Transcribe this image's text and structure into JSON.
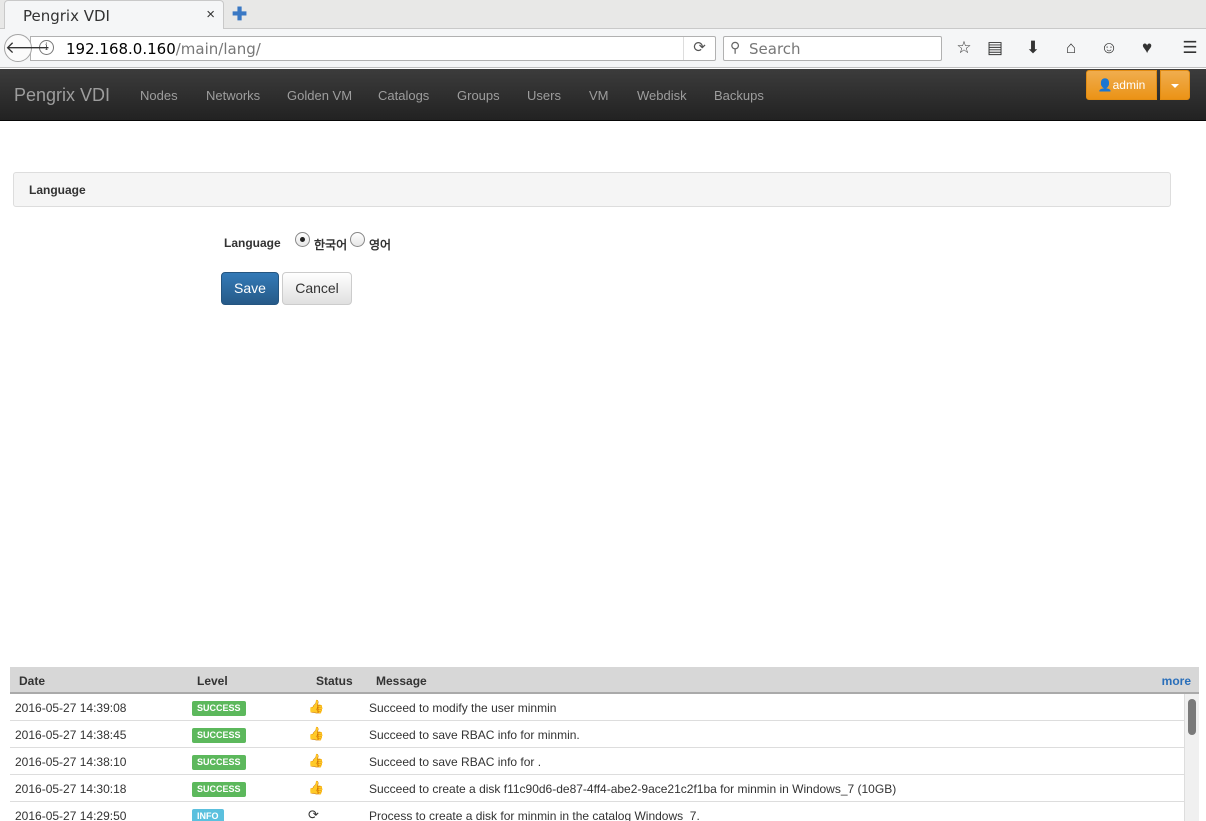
{
  "browser": {
    "tab_title": "Pengrix VDI",
    "tab_close": "×",
    "new_tab": "✚",
    "url_host": "192.168.0.160",
    "url_path": "/main/lang/",
    "search_placeholder": "Search"
  },
  "navbar": {
    "brand": "Pengrix VDI",
    "links": [
      "Nodes",
      "Networks",
      "Golden VM",
      "Catalogs",
      "Groups",
      "Users",
      "VM",
      "Webdisk",
      "Backups"
    ],
    "user": "admin"
  },
  "panel": {
    "title": "Language"
  },
  "form": {
    "label": "Language",
    "options": [
      "한국어",
      "영어"
    ],
    "selected": "한국어",
    "save": "Save",
    "cancel": "Cancel"
  },
  "log": {
    "headers": [
      "Date",
      "Level",
      "Status",
      "Message"
    ],
    "more": "more",
    "rows": [
      {
        "date": "2016-05-27 14:39:08",
        "level": "SUCCESS",
        "status_icon": "thumbs-up-icon",
        "message": "Succeed to modify the user minmin"
      },
      {
        "date": "2016-05-27 14:38:45",
        "level": "SUCCESS",
        "status_icon": "thumbs-up-icon",
        "message": "Succeed to save RBAC info for minmin."
      },
      {
        "date": "2016-05-27 14:38:10",
        "level": "SUCCESS",
        "status_icon": "thumbs-up-icon",
        "message": "Succeed to save RBAC info for ."
      },
      {
        "date": "2016-05-27 14:30:18",
        "level": "SUCCESS",
        "status_icon": "thumbs-up-icon",
        "message": "Succeed to create a disk f11c90d6-de87-4ff4-abe2-9ace21c2f1ba for minmin in Windows_7 (10GB)"
      },
      {
        "date": "2016-05-27 14:29:50",
        "level": "INFO",
        "status_icon": "refresh-icon",
        "message": "Process to create a disk for minmin in the catalog Windows_7."
      }
    ]
  },
  "colors": {
    "brand_primary": "#337ab7",
    "warning": "#f0ad4e",
    "success": "#5cb85c",
    "info": "#5bc0de"
  }
}
